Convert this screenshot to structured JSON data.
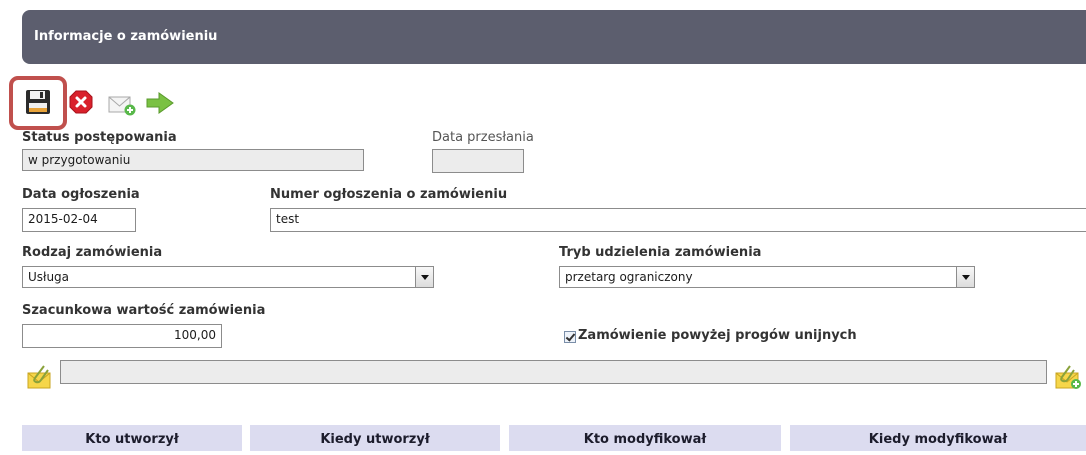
{
  "header": {
    "title": "Informacje o zamówieniu"
  },
  "toolbar": {
    "icons": [
      "save-icon",
      "delete-icon",
      "send-mail-icon",
      "forward-arrow-icon"
    ],
    "highlight_color": "#c0504d"
  },
  "form": {
    "status_label": "Status postępowania",
    "status_value": "w przygotowaniu",
    "sent_date_label": "Data przesłania",
    "sent_date_value": "",
    "announcement_date_label": "Data ogłoszenia",
    "announcement_date_value": "2015-02-04",
    "announcement_number_label": "Numer ogłoszenia o zamówieniu",
    "announcement_number_value": "test",
    "order_type_label": "Rodzaj zamówienia",
    "order_type_value": "Usługa",
    "procedure_label": "Tryb udzielenia zamówienia",
    "procedure_value": "przetarg ograniczony",
    "estimated_value_label": "Szacunkowa wartość zamówienia",
    "estimated_value": "100,00",
    "eu_threshold_label": "Zamówienie powyżej progów unijnych",
    "eu_threshold_checked": true,
    "attachment_value": ""
  },
  "table": {
    "headers": [
      "Kto utworzył",
      "Kiedy utworzył",
      "Kto modyfikował",
      "Kiedy modyfikował"
    ]
  },
  "colors": {
    "header_bg": "#5c5e6e",
    "table_header_bg": "#dcdcf0",
    "readonly_bg": "#ececec"
  }
}
